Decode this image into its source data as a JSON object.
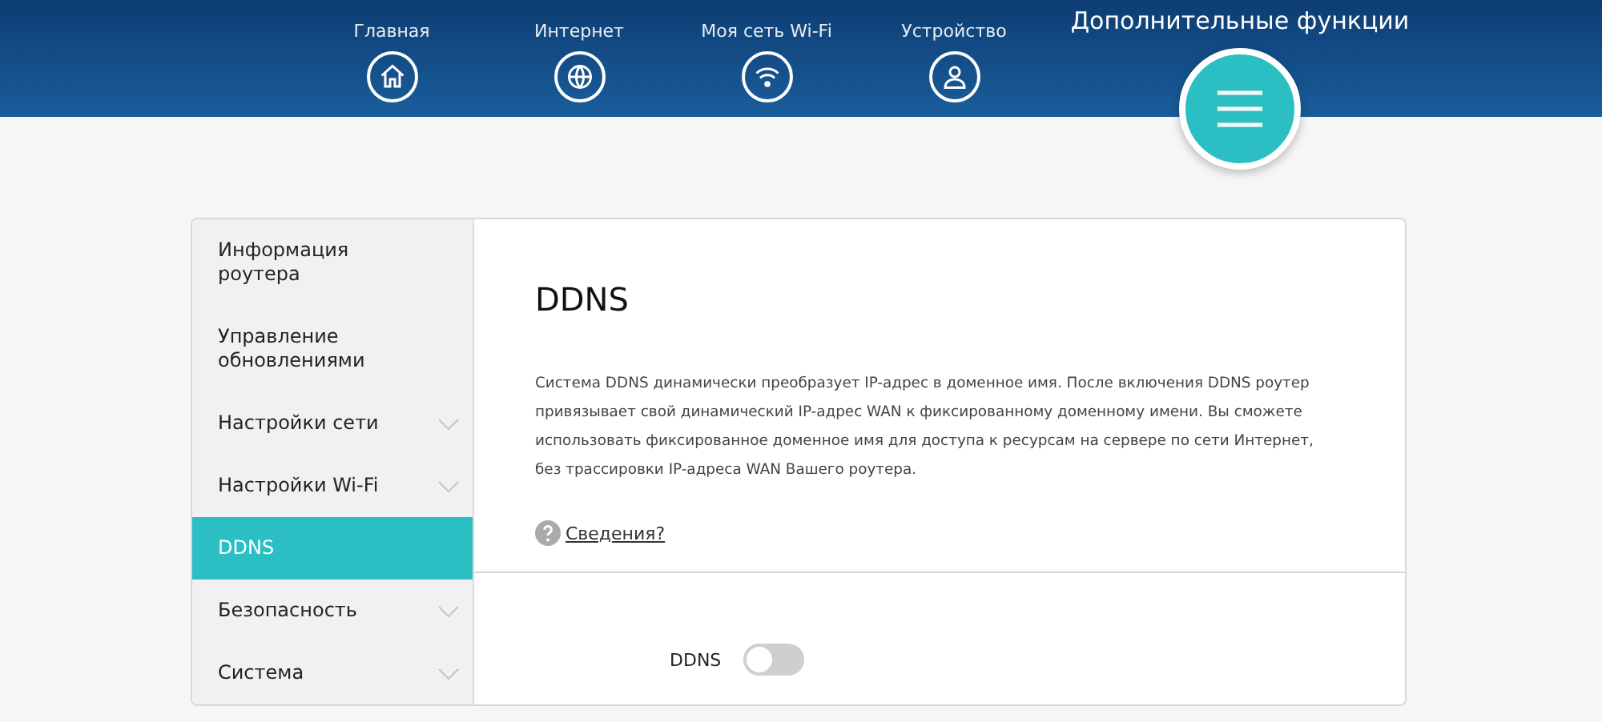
{
  "nav": [
    {
      "label": "Главная",
      "selected": false
    },
    {
      "label": "Интернет",
      "selected": false
    },
    {
      "label": "Моя сеть Wi-Fi",
      "selected": false
    },
    {
      "label": "Устройство",
      "selected": false
    },
    {
      "label": "Дополнительные функции",
      "selected": true
    }
  ],
  "sidebar": {
    "items": [
      {
        "label": "Информация роутера",
        "expandable": false,
        "selected": false
      },
      {
        "label": "Управление обновлениями",
        "expandable": false,
        "selected": false
      },
      {
        "label": "Настройки сети",
        "expandable": true,
        "selected": false
      },
      {
        "label": "Настройки Wi-Fi",
        "expandable": true,
        "selected": false
      },
      {
        "label": "DDNS",
        "expandable": false,
        "selected": true
      },
      {
        "label": "Безопасность",
        "expandable": true,
        "selected": false
      },
      {
        "label": "Система",
        "expandable": true,
        "selected": false
      }
    ]
  },
  "content": {
    "title": "DDNS",
    "description": "Система DDNS динамически преобразует IP-адрес в доменное имя. После включения DDNS роутер привязывает свой динамический IP-адрес WAN к фиксированному доменному имени. Вы сможете использовать фиксированное доменное имя для доступа к ресурсам на сервере по сети Интернет, без трассировки IP-адреса WAN Вашего роутера.",
    "help_link": "Сведения?",
    "toggle": {
      "label": "DDNS",
      "on": false
    }
  }
}
